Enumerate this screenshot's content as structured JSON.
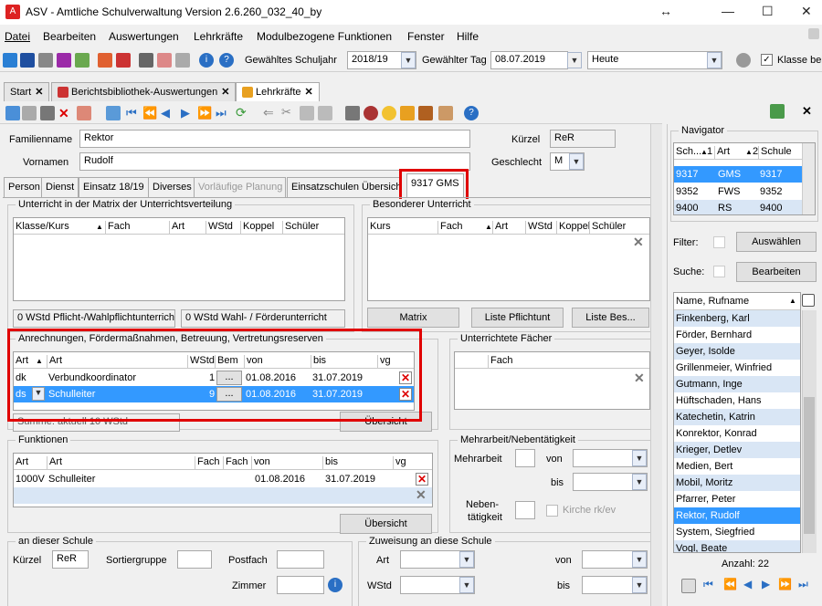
{
  "window": {
    "title": "ASV - Amtliche Schulverwaltung Version 2.6.260_032_40_by"
  },
  "menu": [
    "Datei",
    "Bearbeiten",
    "Auswertungen",
    "Lehrkräfte",
    "Modulbezogene Funktionen",
    "Fenster",
    "Hilfe"
  ],
  "toolbar": {
    "schuljahr_label": "Gewähltes Schuljahr",
    "schuljahr": "2018/19",
    "tag_label": "Gewählter Tag",
    "tag": "08.07.2019",
    "heute": "Heute",
    "klasse_label": "Klasse bei"
  },
  "tabs": [
    {
      "label": "Start"
    },
    {
      "label": "Berichtsbibliothek-Auswertungen"
    },
    {
      "label": "Lehrkräfte"
    }
  ],
  "person": {
    "familienname_label": "Familienname",
    "familienname": "Rektor",
    "vornamen_label": "Vornamen",
    "vornamen": "Rudolf",
    "kuerzel_label": "Kürzel",
    "kuerzel": "ReR",
    "geschlecht_label": "Geschlecht",
    "geschlecht": "M"
  },
  "page_tabs": [
    "Person",
    "Dienst",
    "Einsatz 18/19",
    "Diverses",
    "Vorläufige Planung",
    "Einsatzschulen Übersicht",
    "9317 GMS"
  ],
  "unterricht": {
    "title": "Unterricht in der Matrix der Unterrichtsverteilung",
    "cols": [
      "Klasse/Kurs",
      "Fach",
      "Art",
      "WStd",
      "Koppel",
      "Schüler"
    ],
    "pflicht": "0 WStd Pflicht-/Wahlpflichtunterricht",
    "wahl": "0 WStd Wahl- / Förderunterricht"
  },
  "besonderer": {
    "title": "Besonderer Unterricht",
    "cols": [
      "Kurs",
      "Fach",
      "Art",
      "WStd",
      "Koppel",
      "Schüler"
    ],
    "btn_matrix": "Matrix",
    "btn_liste": "Liste Pflichtunt",
    "btn_liste_bes": "Liste Bes..."
  },
  "anrechnungen": {
    "title": "Anrechnungen, Fördermaßnahmen, Betreuung, Vertretungsreserven",
    "cols": [
      "Art",
      "Art",
      "WStd",
      "Bem",
      "von",
      "bis",
      "vg"
    ],
    "rows": [
      {
        "art": "dk",
        "bez": "Verbundkoordinator",
        "wstd": "1",
        "bem": "...",
        "von": "01.08.2016",
        "bis": "31.07.2019"
      },
      {
        "art": "ds",
        "bez": "Schulleiter",
        "wstd": "9",
        "bem": "...",
        "von": "01.08.2016",
        "bis": "31.07.2019"
      }
    ],
    "summe": "Summe: aktuell 10 WStd",
    "btn": "Übersicht"
  },
  "faecher": {
    "title": "Unterrichtete Fächer",
    "cols": [
      "Fach"
    ]
  },
  "funktionen": {
    "title": "Funktionen",
    "cols": [
      "Art",
      "Art",
      "Fach",
      "Fach",
      "von",
      "bis",
      "vg"
    ],
    "rows": [
      {
        "art": "1000V",
        "bez": "Schulleiter",
        "von": "01.08.2016",
        "bis": "31.07.2019"
      }
    ],
    "btn": "Übersicht"
  },
  "mehrarbeit": {
    "title": "Mehrarbeit/Nebentätigkeit",
    "mehrarbeit": "Mehrarbeit",
    "von": "von",
    "bis": "bis",
    "neben1": "Neben-",
    "neben2": "tätigkeit",
    "kirche": "Kirche rk/ev"
  },
  "schule": {
    "title": "an dieser Schule",
    "kuerzel_label": "Kürzel",
    "kuerzel": "ReR",
    "sortier": "Sortiergruppe",
    "postfach": "Postfach",
    "zimmer": "Zimmer"
  },
  "zuweisung": {
    "title": "Zuweisung an diese Schule",
    "art": "Art",
    "wstd": "WStd",
    "von": "von",
    "bis": "bis"
  },
  "navigator": {
    "title": "Navigator",
    "cols": [
      "Sch...",
      "1",
      "Art",
      "2",
      "Schule"
    ],
    "schools": [
      {
        "sch": "9317",
        "art": "GMS",
        "schule": "9317"
      },
      {
        "sch": "9352",
        "art": "FWS",
        "schule": "9352"
      },
      {
        "sch": "9400",
        "art": "RS",
        "schule": "9400"
      }
    ],
    "filter": "Filter:",
    "btn_select": "Auswählen",
    "suche": "Suche:",
    "btn_edit": "Bearbeiten",
    "list_header": "Name, Rufname",
    "names": [
      "Finkenberg, Karl",
      "Förder, Bernhard",
      "Geyer, Isolde",
      "Grillenmeier, Winfried",
      "Gutmann, Inge",
      "Hüftschaden, Hans",
      "Katechetin, Katrin",
      "Konrektor, Konrad",
      "Krieger, Detlev",
      "Medien, Bert",
      "Mobil, Moritz",
      "Pfarrer, Peter",
      "Rektor, Rudolf",
      "System, Siegfried",
      "Vogl, Beate"
    ],
    "count": "Anzahl: 22"
  }
}
